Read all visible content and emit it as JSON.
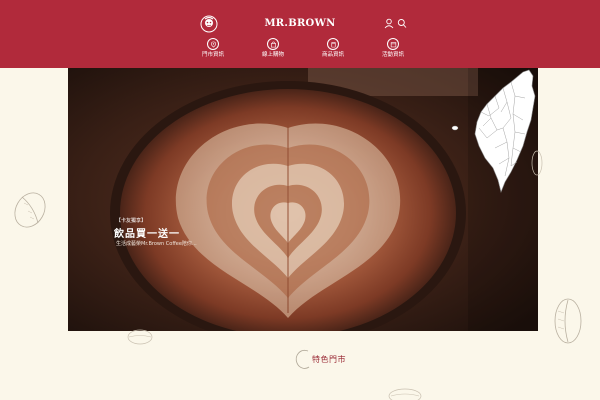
{
  "header": {
    "brand": "MR.BROWN",
    "nav": [
      {
        "label": "門市資訊",
        "icon": "location-icon"
      },
      {
        "label": "線上購物",
        "icon": "shopping-bag-icon"
      },
      {
        "label": "商品資訊",
        "icon": "cup-icon"
      },
      {
        "label": "活動資訊",
        "icon": "calendar-icon"
      }
    ]
  },
  "hero": {
    "tag": "【卡友獨享】",
    "title": "飲品買一送一",
    "description": "生活成藝榮Mr.Brown Coffee陪你..."
  },
  "featured": {
    "title": "特色門市"
  },
  "colors": {
    "brand_red": "#b12a3b",
    "page_bg": "#fbf7ea",
    "featured_red": "#9a2a35"
  }
}
